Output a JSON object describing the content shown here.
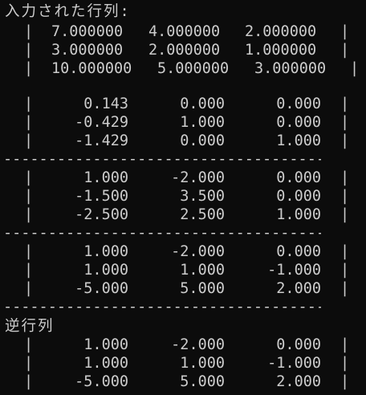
{
  "console": {
    "input_title": "入力された行列:",
    "inverse_title": "逆行列",
    "bar_char": "|",
    "dash_line": "-----------------------------------------------",
    "input_rows": [
      [
        "7.000000",
        "4.000000",
        "2.000000"
      ],
      [
        "3.000000",
        "2.000000",
        "1.000000"
      ],
      [
        "10.000000",
        "5.000000",
        "3.000000"
      ]
    ],
    "step1_rows": [
      [
        "0.143",
        "0.000",
        "0.000"
      ],
      [
        "-0.429",
        "1.000",
        "0.000"
      ],
      [
        "-1.429",
        "0.000",
        "1.000"
      ]
    ],
    "step2_rows": [
      [
        "1.000",
        "-2.000",
        "0.000"
      ],
      [
        "-1.500",
        "3.500",
        "0.000"
      ],
      [
        "-2.500",
        "2.500",
        "1.000"
      ]
    ],
    "step3_rows": [
      [
        "1.000",
        "-2.000",
        "0.000"
      ],
      [
        "1.000",
        "1.000",
        "-1.000"
      ],
      [
        "-5.000",
        "5.000",
        "2.000"
      ]
    ],
    "inverse_rows": [
      [
        "1.000",
        "-2.000",
        "0.000"
      ],
      [
        "1.000",
        "1.000",
        "-1.000"
      ],
      [
        "-5.000",
        "5.000",
        "2.000"
      ]
    ]
  }
}
